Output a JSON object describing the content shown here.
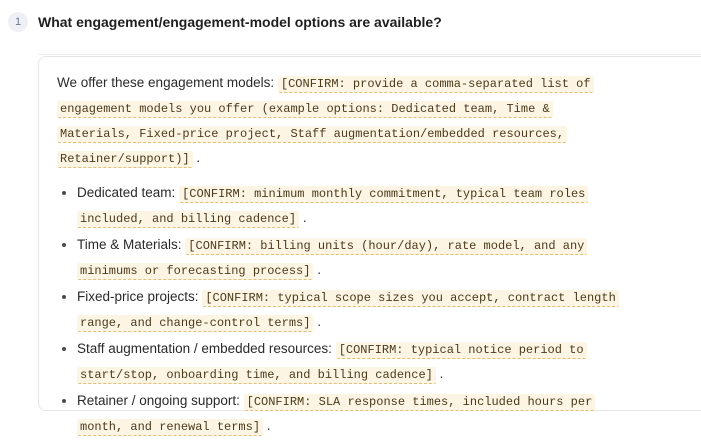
{
  "question": {
    "number": "1",
    "text": "What engagement/engagement-model options are available?"
  },
  "answer": {
    "intro": "We offer these engagement models:",
    "intro_confirm": "[CONFIRM: provide a comma-separated list of engagement models you offer (example options: Dedicated team, Time & Materials, Fixed-price project, Staff augmentation/embedded resources, Retainer/support)]",
    "intro_end": ".",
    "items": [
      {
        "label": "Dedicated team:",
        "confirm": "[CONFIRM: minimum monthly commitment, typical team roles included, and billing cadence]",
        "end": "."
      },
      {
        "label": "Time & Materials:",
        "confirm": "[CONFIRM: billing units (hour/day), rate model, and any minimums or forecasting process]",
        "end": "."
      },
      {
        "label": "Fixed-price projects:",
        "confirm": "[CONFIRM: typical scope sizes you accept, contract length range, and change-control terms]",
        "end": "."
      },
      {
        "label": "Staff augmentation / embedded resources:",
        "confirm": "[CONFIRM: typical notice period to start/stop, onboarding time, and billing cadence]",
        "end": "."
      },
      {
        "label": "Retainer / ongoing support:",
        "confirm": "[CONFIRM: SLA response times, included hours per month, and renewal terms]",
        "end": "."
      }
    ]
  }
}
